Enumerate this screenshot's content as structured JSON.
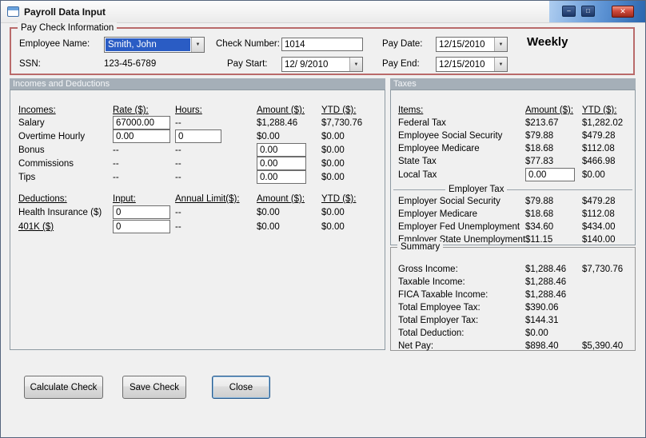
{
  "window": {
    "title": "Payroll Data Input"
  },
  "icons": {
    "minimize": "–",
    "maximize": "□",
    "close": "✕",
    "dropdown": "▼"
  },
  "colors": {
    "groupbox_border": "#b96a6a",
    "section_band_bg": "#a5afb8",
    "selection_bg": "#2a5cc4",
    "close_button_bg": "#cf4a3c"
  },
  "paycheck": {
    "group_label": "Pay Check Information",
    "employee_name": {
      "label": "Employee Name:",
      "value": "Smith, John"
    },
    "ssn": {
      "label": "SSN:",
      "value": "123-45-6789"
    },
    "check_number": {
      "label": "Check Number:",
      "value": "1014"
    },
    "pay_start": {
      "label": "Pay Start:",
      "value": "12/ 9/2010"
    },
    "pay_date": {
      "label": "Pay Date:",
      "value": "12/15/2010"
    },
    "pay_end": {
      "label": "Pay End:",
      "value": "12/15/2010"
    },
    "frequency": "Weekly"
  },
  "sections": {
    "incomes_and_deductions": "Incomes and Deductions",
    "taxes": "Taxes"
  },
  "incomes": {
    "headers": {
      "item": "Incomes:",
      "rate": "Rate ($):",
      "hours": "Hours:",
      "amount": "Amount ($):",
      "ytd": "YTD ($):"
    },
    "salary": {
      "label": "Salary",
      "rate": "67000.00",
      "hours": "--",
      "amount": "$1,288.46",
      "ytd": "$7,730.76"
    },
    "overtime": {
      "label": "Overtime Hourly",
      "rate": "0.00",
      "hours": "0",
      "amount": "$0.00",
      "ytd": "$0.00"
    },
    "bonus": {
      "label": "Bonus",
      "rate": "--",
      "hours": "--",
      "amount": "0.00",
      "ytd": "$0.00"
    },
    "commissions": {
      "label": "Commissions",
      "rate": "--",
      "hours": "--",
      "amount": "0.00",
      "ytd": "$0.00"
    },
    "tips": {
      "label": "Tips",
      "rate": "--",
      "hours": "--",
      "amount": "0.00",
      "ytd": "$0.00"
    }
  },
  "deductions": {
    "headers": {
      "item": "Deductions:",
      "input": "Input:",
      "limit": "Annual Limit($):",
      "amount": "Amount ($):",
      "ytd": "YTD ($):"
    },
    "health": {
      "label": "Health Insurance  ($)",
      "input": "0",
      "limit": "--",
      "amount": "$0.00",
      "ytd": "$0.00"
    },
    "k401": {
      "label": "401K  ($)",
      "input": "0",
      "limit": "--",
      "amount": "$0.00",
      "ytd": "$0.00"
    }
  },
  "taxes": {
    "headers": {
      "item": "Items:",
      "amount": "Amount ($):",
      "ytd": "YTD ($):"
    },
    "federal": {
      "label": "Federal Tax",
      "amount": "$213.67",
      "ytd": "$1,282.02"
    },
    "emp_ss": {
      "label": "Employee Social Security",
      "amount": "$79.88",
      "ytd": "$479.28"
    },
    "emp_medicare": {
      "label": "Employee Medicare",
      "amount": "$18.68",
      "ytd": "$112.08"
    },
    "state": {
      "label": "State Tax",
      "amount": "$77.83",
      "ytd": "$466.98"
    },
    "local": {
      "label": "Local Tax",
      "amount": "0.00",
      "ytd": "$0.00"
    },
    "employer_header": "Employer Tax",
    "er_ss": {
      "label": "Employer Social Security",
      "amount": "$79.88",
      "ytd": "$479.28"
    },
    "er_medicare": {
      "label": "Employer Medicare",
      "amount": "$18.68",
      "ytd": "$112.08"
    },
    "er_fed_unemp": {
      "label": "Employer Fed Unemployment",
      "amount": "$34.60",
      "ytd": "$434.00"
    },
    "er_state_unemp": {
      "label": "Employer State Unemployment",
      "amount": "$11.15",
      "ytd": "$140.00"
    }
  },
  "summary": {
    "group_label": "Summary",
    "gross": {
      "label": "Gross Income:",
      "amount": "$1,288.46",
      "ytd": "$7,730.76"
    },
    "taxable": {
      "label": "Taxable Income:",
      "amount": "$1,288.46",
      "ytd": ""
    },
    "fica": {
      "label": "FICA Taxable Income:",
      "amount": "$1,288.46",
      "ytd": ""
    },
    "total_employee_tax": {
      "label": "Total Employee Tax:",
      "amount": "$390.06",
      "ytd": ""
    },
    "total_employer_tax": {
      "label": "Total Employer Tax:",
      "amount": "$144.31",
      "ytd": ""
    },
    "total_deduction": {
      "label": "Total Deduction:",
      "amount": "$0.00",
      "ytd": ""
    },
    "net_pay": {
      "label": "Net Pay:",
      "amount": "$898.40",
      "ytd": "$5,390.40"
    }
  },
  "buttons": {
    "calculate": "Calculate Check",
    "save": "Save Check",
    "close": "Close"
  }
}
